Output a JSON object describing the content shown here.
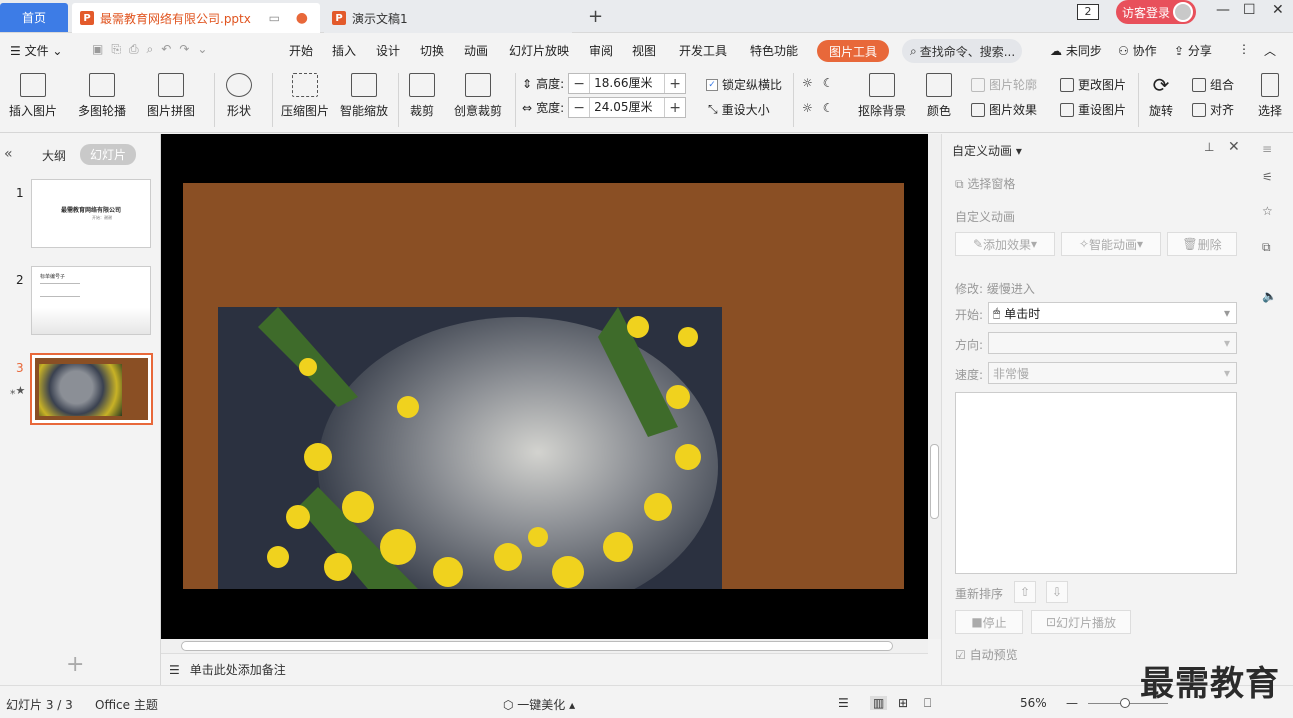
{
  "tabs": {
    "home": "首页",
    "doc1": "最需教育网络有限公司.pptx",
    "doc2": "演示文稿1",
    "count_badge": "2",
    "visitor_login": "访客登录"
  },
  "menu": {
    "file": "文件",
    "items": [
      "开始",
      "插入",
      "设计",
      "切换",
      "动画",
      "幻灯片放映",
      "审阅",
      "视图",
      "开发工具",
      "特色功能"
    ],
    "picture_tools": "图片工具",
    "search_placeholder": "查找命令、搜索...",
    "unsynced": "未同步",
    "collab": "协作",
    "share": "分享"
  },
  "ribbon": {
    "insert_picture": "插入图片",
    "multi_carousel": "多图轮播",
    "picture_collage": "图片拼图",
    "shape": "形状",
    "compress": "压缩图片",
    "smart_zoom": "智能缩放",
    "crop": "裁剪",
    "creative_crop": "创意裁剪",
    "height_label": "高度:",
    "height_value": "18.66厘米",
    "width_label": "宽度:",
    "width_value": "24.05厘米",
    "lock_ratio": "锁定纵横比",
    "resize": "重设大小",
    "remove_bg": "抠除背景",
    "color": "颜色",
    "pic_outline": "图片轮廓",
    "pic_effect": "图片效果",
    "change_pic": "更改图片",
    "reset_pic": "重设图片",
    "rotate": "旋转",
    "group": "组合",
    "align": "对齐",
    "select": "选择"
  },
  "left_panel": {
    "outline_tab": "大纲",
    "slides_tab": "幻灯片",
    "slide1_title": "最需教育网络有限公司",
    "slide1_sub": "开始：谢谢",
    "slide2_title": "标单编号子",
    "nums": [
      "1",
      "2",
      "3"
    ]
  },
  "notes": {
    "placeholder": "单击此处添加备注"
  },
  "right_panel": {
    "title": "自定义动画",
    "select_pane": "选择窗格",
    "section": "自定义动画",
    "add_effect": "添加效果",
    "smart_anim": "智能动画",
    "delete": "删除",
    "modify": "修改: 缓慢进入",
    "start_label": "开始:",
    "start_value": "单击时",
    "direction_label": "方向:",
    "speed_label": "速度:",
    "speed_value": "非常慢",
    "reorder": "重新排序",
    "stop": "停止",
    "slideshow": "幻灯片播放",
    "autopreview": "自动预览"
  },
  "status": {
    "slide_info": "幻灯片 3 / 3",
    "theme": "Office 主题",
    "beautify": "一键美化",
    "zoom": "56%",
    "watermark": "最需教育"
  },
  "colors": {
    "accent": "#3d7ce6",
    "picture_tools": "#e8683a",
    "slide_bg": "#8a4f24"
  }
}
